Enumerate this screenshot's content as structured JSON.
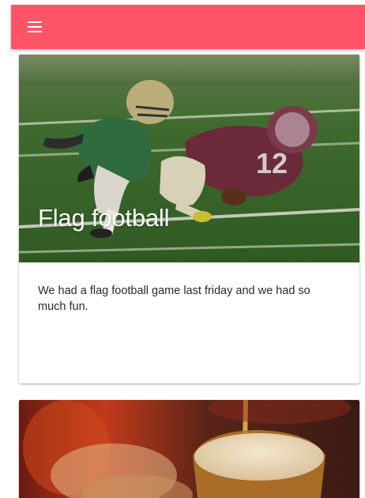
{
  "appbar": {
    "color": "#ff5468",
    "menu_icon": "hamburger-menu-icon"
  },
  "cards": [
    {
      "title": "Flag football",
      "body": "We had a flag football game last friday and we had so much fun.",
      "image": "football-players-tackle-photo"
    },
    {
      "image": "beer-glass-pour-photo"
    }
  ]
}
